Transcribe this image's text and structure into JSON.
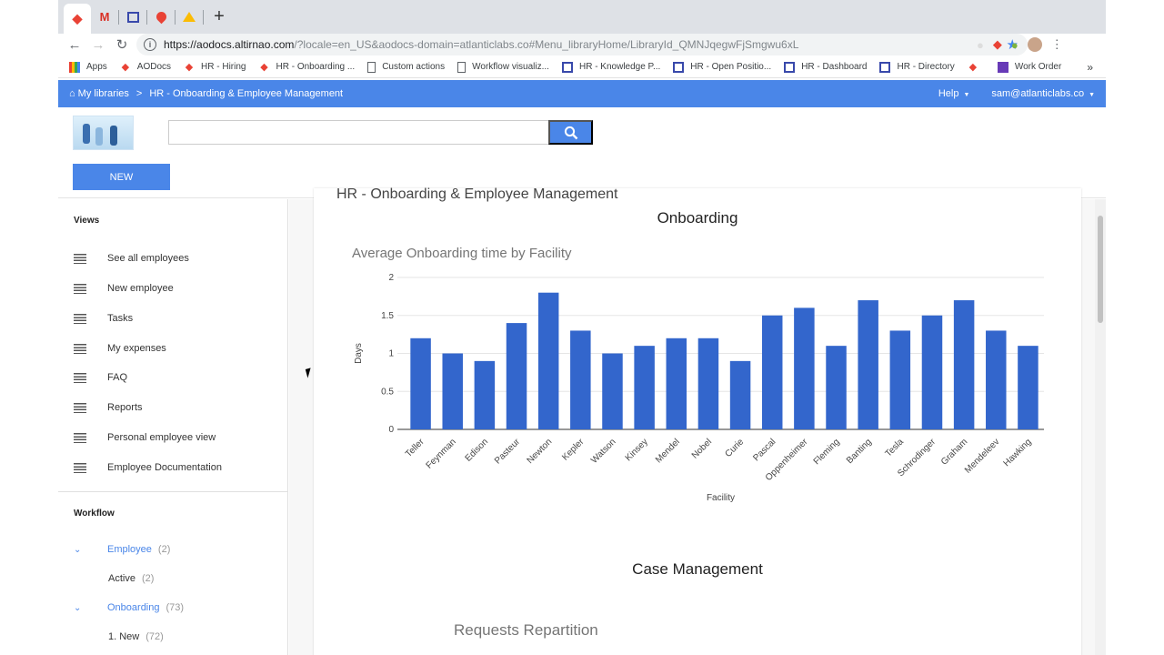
{
  "browser": {
    "tabs": [
      "aodocs-tab",
      "gmail-tab",
      "calendar-tab",
      "maps-tab",
      "drive-tab"
    ],
    "url_host": "https://aodocs.altirnao.com",
    "url_rest": "/?locale=en_US&aodocs-domain=atlanticlabs.co#Menu_libraryHome/LibraryId_QMNJqegwFjSmgwu6xL",
    "bookmarks": [
      {
        "label": "Apps",
        "icon": "apps-grid-icon"
      },
      {
        "label": "AODocs",
        "icon": "aodocs-icon"
      },
      {
        "label": "HR - Hiring",
        "icon": "aodocs-icon"
      },
      {
        "label": "HR - Onboarding ...",
        "icon": "aodocs-icon"
      },
      {
        "label": "Custom actions",
        "icon": "page-icon"
      },
      {
        "label": "Workflow visualiz...",
        "icon": "page-icon"
      },
      {
        "label": "HR - Knowledge P...",
        "icon": "workspace-icon"
      },
      {
        "label": "HR - Open Positio...",
        "icon": "workspace-icon"
      },
      {
        "label": "HR - Dashboard",
        "icon": "workspace-icon"
      },
      {
        "label": "HR - Directory",
        "icon": "workspace-icon"
      },
      {
        "label": "",
        "icon": "aodocs-icon"
      },
      {
        "label": "Work Order",
        "icon": "form-icon"
      }
    ],
    "bookmarks_more": "»"
  },
  "appbar": {
    "home_label": "My libraries",
    "separator": ">",
    "library_name": "HR - Onboarding & Employee Management",
    "help_label": "Help",
    "user_email": "sam@atlanticlabs.co"
  },
  "toolbar": {
    "search_placeholder": "",
    "new_label": "NEW"
  },
  "sidebar": {
    "views_title": "Views",
    "views": [
      "See all employees",
      "New employee",
      "Tasks",
      "My expenses",
      "FAQ",
      "Reports",
      "Personal employee view",
      "Employee Documentation"
    ],
    "workflow_title": "Workflow",
    "workflow": [
      {
        "label": "Employee",
        "count": "(2)",
        "sub": [
          {
            "label": "Active",
            "count": "(2)"
          }
        ]
      },
      {
        "label": "Onboarding",
        "count": "(73)",
        "sub": [
          {
            "label": "1. New",
            "count": "(72)"
          }
        ]
      }
    ]
  },
  "main": {
    "page_title": "HR - Onboarding & Employee Management",
    "section1_title": "Onboarding",
    "section2_title": "Case Management",
    "next_chart_title": "Requests Repartition"
  },
  "chart_data": {
    "type": "bar",
    "title": "Average Onboarding time by Facility",
    "xlabel": "Facility",
    "ylabel": "Days",
    "ylim": [
      0,
      2
    ],
    "yticks": [
      "0",
      "0.5",
      "1",
      "1.5",
      "2"
    ],
    "bar_color": "#3366cc",
    "categories": [
      "Teller",
      "Feynman",
      "Edison",
      "Pasteur",
      "Newton",
      "Kepler",
      "Watson",
      "Kinsey",
      "Mendel",
      "Nobel",
      "Curie",
      "Pascal",
      "Oppenheimer",
      "Fleming",
      "Banting",
      "Tesla",
      "Schrodinger",
      "Graham",
      "Mendeleev",
      "Hawking"
    ],
    "values": [
      1.2,
      1.0,
      0.9,
      1.4,
      1.8,
      1.3,
      1.0,
      1.1,
      1.2,
      1.2,
      0.9,
      1.5,
      1.6,
      1.1,
      1.7,
      1.3,
      1.5,
      1.7,
      1.3,
      1.1
    ]
  },
  "colors": {
    "accent": "#4a86e8",
    "bar": "#3366cc"
  }
}
